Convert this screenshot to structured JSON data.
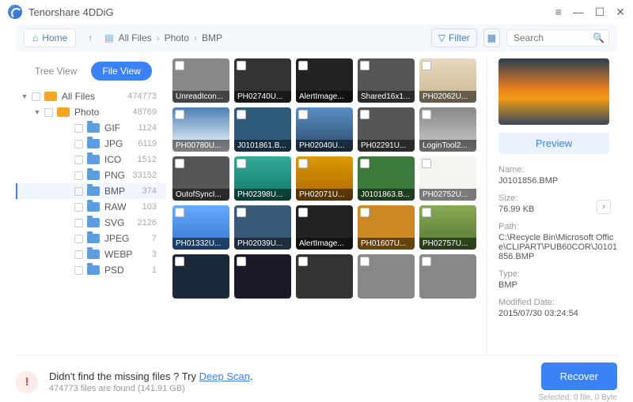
{
  "app_title": "Tenorshare 4DDiG",
  "toolbar": {
    "home": "Home",
    "breadcrumb": [
      "All Files",
      "Photo",
      "BMP"
    ],
    "filter": "Filter",
    "search_placeholder": "Search"
  },
  "sidebar": {
    "tree_view": "Tree View",
    "file_view": "File View",
    "root": {
      "label": "All Files",
      "count": "474773"
    },
    "photo": {
      "label": "Photo",
      "count": "48769"
    },
    "items": [
      {
        "label": "GIF",
        "count": "1124"
      },
      {
        "label": "JPG",
        "count": "6119"
      },
      {
        "label": "ICO",
        "count": "1512"
      },
      {
        "label": "PNG",
        "count": "33152"
      },
      {
        "label": "BMP",
        "count": "374",
        "selected": true
      },
      {
        "label": "RAW",
        "count": "103"
      },
      {
        "label": "SVG",
        "count": "2126"
      },
      {
        "label": "JPEG",
        "count": "7"
      },
      {
        "label": "WEBP",
        "count": "3"
      },
      {
        "label": "PSD",
        "count": "1"
      }
    ]
  },
  "thumbs": [
    "UnreadIcon...",
    "PH02740U...",
    "AlertImage...",
    "Shared16x1...",
    "PH02062U...",
    "PH00780U...",
    "J0101861.B...",
    "PH02040U...",
    "PH02291U...",
    "LoginTool2...",
    "OutofSyncI...",
    "PH02398U...",
    "PH02071U...",
    "J0101863.B...",
    "PH02752U...",
    "PH01332U...",
    "PH02039U...",
    "AlertImage...",
    "PH01607U...",
    "PH02757U...",
    "",
    "",
    "",
    "",
    ""
  ],
  "details": {
    "preview_btn": "Preview",
    "name_label": "Name:",
    "name": "J0101856.BMP",
    "size_label": "Size:",
    "size": "76.99 KB",
    "path_label": "Path:",
    "path": "C:\\Recycle Bin\\Microsoft Office\\CLIPART\\PUB60COR\\J0101856.BMP",
    "type_label": "Type:",
    "type": "BMP",
    "mod_label": "Modified Date:",
    "mod": "2015/07/30 03:24:54"
  },
  "footer": {
    "msg_prefix": "Didn't find the missing files ? Try ",
    "msg_link": "Deep Scan",
    "msg_suffix": ".",
    "sub": "474773 files are found (141.91 GB)",
    "recover": "Recover",
    "selected": "Selected: 0 file, 0 Byte"
  }
}
